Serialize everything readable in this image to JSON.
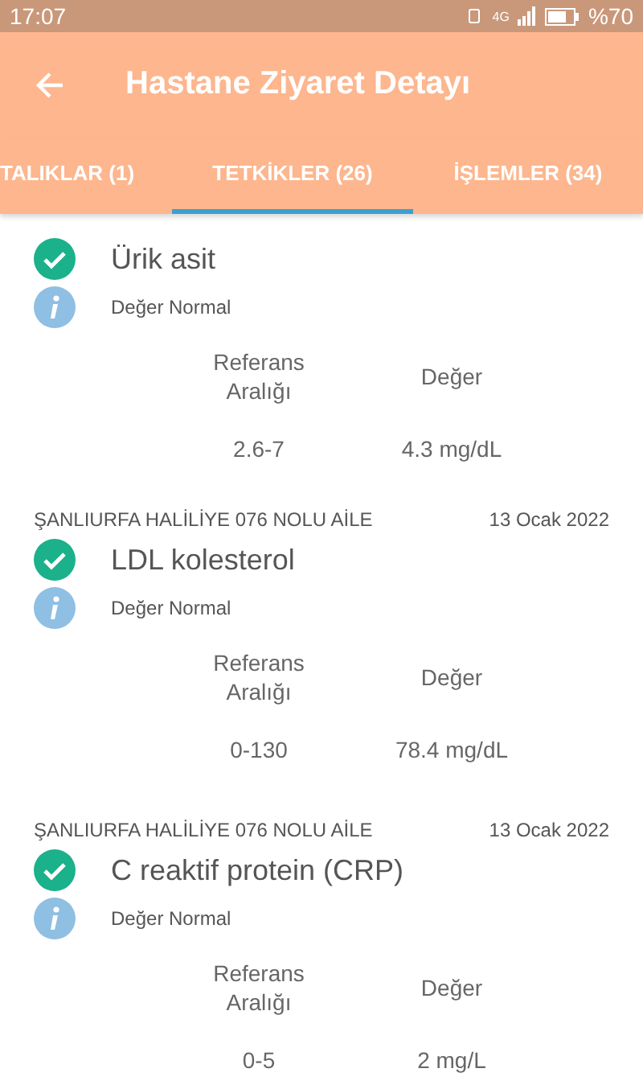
{
  "status_bar": {
    "time": "17:07",
    "network": "4G",
    "battery_text": "%70"
  },
  "app_bar": {
    "title": "Hastane Ziyaret Detayı"
  },
  "tabs": [
    {
      "label": "TALIKLAR (1)",
      "selected": false
    },
    {
      "label": "TETKİKLER (26)",
      "selected": true
    },
    {
      "label": "İŞLEMLER (34)",
      "selected": false
    }
  ],
  "tests": [
    {
      "name": "Ürik asit",
      "checked": true,
      "note": "Değer Normal",
      "ref_header": "Referans Aralığı",
      "value_header": "Değer",
      "ref": "2.6-7",
      "value": "4.3 mg/dL"
    },
    {
      "facility": "ŞANLIURFA HALİLİYE 076 NOLU AİLE",
      "date": "13 Ocak 2022",
      "name": "LDL kolesterol",
      "checked": true,
      "note": "Değer Normal",
      "ref_header": "Referans Aralığı",
      "value_header": "Değer",
      "ref": "0-130",
      "value": "78.4 mg/dL"
    },
    {
      "facility": "ŞANLIURFA HALİLİYE 076 NOLU AİLE",
      "date": "13 Ocak 2022",
      "name": "C reaktif protein (CRP)",
      "checked": true,
      "note": "Değer Normal",
      "ref_header": "Referans Aralığı",
      "value_header": "Değer",
      "ref": "0-5",
      "value": "2 mg/L"
    }
  ]
}
